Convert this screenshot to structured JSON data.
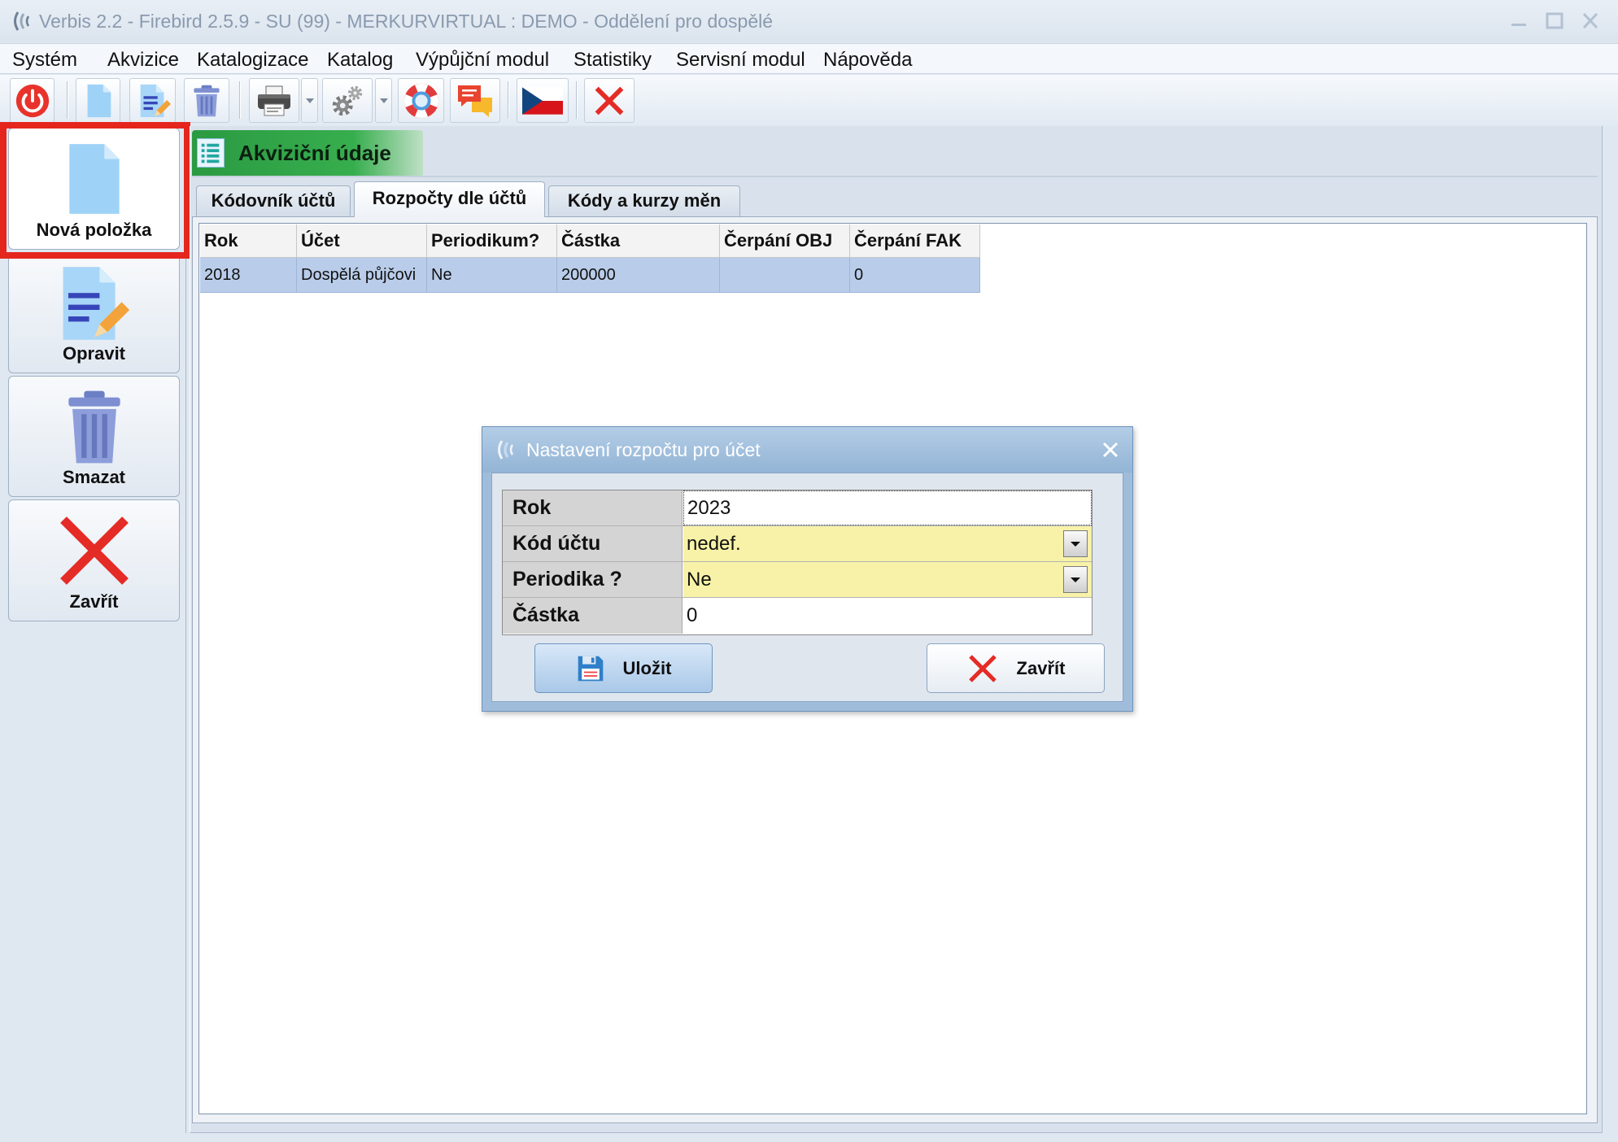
{
  "window": {
    "title": "Verbis 2.2 - Firebird 2.5.9 - SU (99) - MERKURVIRTUAL : DEMO - Oddělení pro dospělé",
    "logo_icon": "verbis-logo-icon",
    "controls": [
      "minimize-icon",
      "maximize-icon",
      "close-icon"
    ]
  },
  "menu": [
    "Systém",
    "Akvizice",
    "Katalogizace",
    "Katalog",
    "Výpůjční modul",
    "Statistiky",
    "Servisní modul",
    "Nápověda"
  ],
  "toolbar": {
    "icons": [
      "power-icon",
      "new-document-icon",
      "edit-document-icon",
      "trash-icon",
      "printer-icon",
      "dropdown-arrow-icon",
      "settings-gear-icon",
      "dropdown-arrow-icon",
      "help-lifebuoy-icon",
      "chat-messages-icon",
      "czech-flag-icon",
      "close-x-icon"
    ]
  },
  "sidebar": {
    "buttons": [
      {
        "label": "Nová položka",
        "icon": "new-document-icon",
        "highlighted": true
      },
      {
        "label": "Opravit",
        "icon": "edit-document-icon",
        "highlighted": false
      },
      {
        "label": "Smazat",
        "icon": "trash-icon",
        "highlighted": false
      },
      {
        "label": "Zavřít",
        "icon": "close-x-icon",
        "highlighted": false
      }
    ]
  },
  "panel": {
    "title": "Akviziční údaje",
    "icon": "list-icon"
  },
  "tabs": [
    {
      "label": "Kódovník účtů",
      "active": false
    },
    {
      "label": "Rozpočty dle účtů",
      "active": true
    },
    {
      "label": "Kódy a kurzy měn",
      "active": false
    }
  ],
  "grid": {
    "columns": [
      "Rok",
      "Účet",
      "Periodikum?",
      "Částka",
      "Čerpání OBJ",
      "Čerpání FAK"
    ],
    "rows": [
      [
        "2018",
        "Dospělá půjčovi",
        "Ne",
        "200000",
        "",
        "0"
      ]
    ],
    "selected_row": 0
  },
  "dialog": {
    "title": "Nastavení rozpočtu pro účet",
    "fields": [
      {
        "label": "Rok",
        "value": "2023",
        "type": "text"
      },
      {
        "label": "Kód účtu",
        "value": "nedef.",
        "type": "select"
      },
      {
        "label": "Periodika ?",
        "value": "Ne",
        "type": "select"
      },
      {
        "label": "Částka",
        "value": "0",
        "type": "text"
      }
    ],
    "save_label": "Uložit",
    "save_icon": "floppy-disk-icon",
    "close_label": "Zavřít",
    "close_icon": "close-x-icon"
  },
  "colors": {
    "highlight_outline": "#e5261d",
    "panel_tab_green": "#2b9a42",
    "selected_row": "#b9cdea",
    "select_field_yellow": "#f7f2a7",
    "dialog_frame": "#9fbddb"
  }
}
